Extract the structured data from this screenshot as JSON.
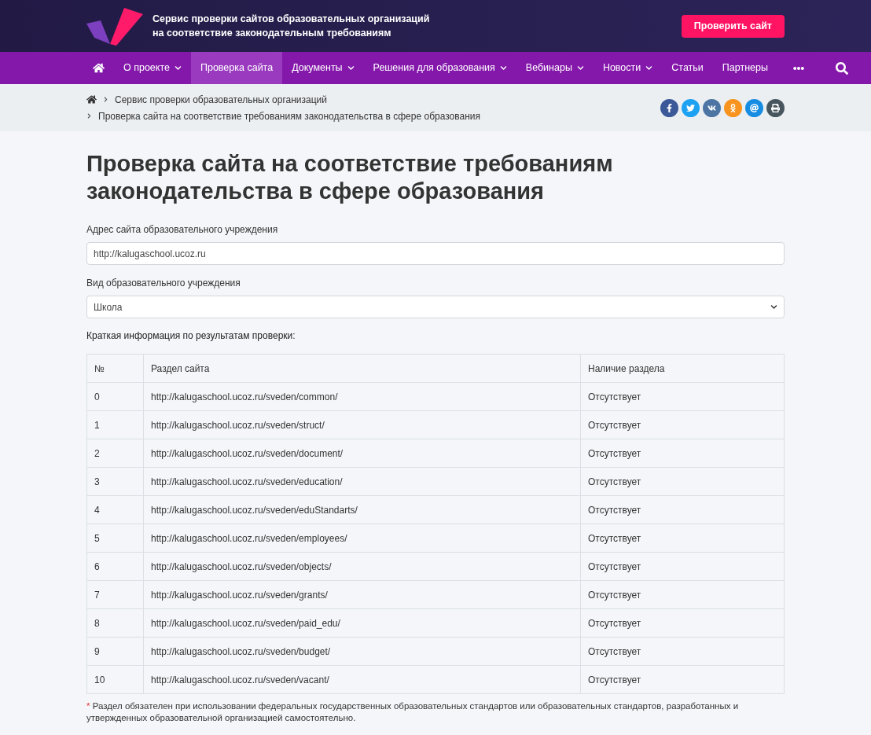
{
  "header": {
    "tagline": [
      "Сервис проверки сайтов образовательных организаций",
      "на соответствие законодательным требованиям"
    ],
    "cta": "Проверить сайт"
  },
  "nav": {
    "items": [
      {
        "kind": "home",
        "selected": false
      },
      {
        "label": "О проекте",
        "dropdown": true,
        "selected": false
      },
      {
        "label": "Проверка сайта",
        "dropdown": false,
        "selected": true
      },
      {
        "label": "Документы",
        "dropdown": true,
        "selected": false
      },
      {
        "label": "Решения для образования",
        "dropdown": true,
        "selected": false
      },
      {
        "label": "Вебинары",
        "dropdown": true,
        "selected": false
      },
      {
        "label": "Новости",
        "dropdown": true,
        "selected": false
      },
      {
        "label": "Статьи",
        "dropdown": false,
        "selected": false
      },
      {
        "label": "Партнеры",
        "dropdown": false,
        "selected": false
      },
      {
        "kind": "more",
        "selected": false
      },
      {
        "kind": "search",
        "selected": false
      }
    ]
  },
  "breadcrumbs": [
    "Сервис проверки образовательных организаций",
    "Проверка сайта на соответствие требованиям законодательства в сфере образования"
  ],
  "share": [
    {
      "kind": "facebook",
      "color": "#3b5998"
    },
    {
      "kind": "twitter",
      "color": "#1da1f2"
    },
    {
      "kind": "vk",
      "color": "#4c75a3"
    },
    {
      "kind": "ok",
      "color": "#f7931e"
    },
    {
      "kind": "mail",
      "color": "#168de2"
    },
    {
      "kind": "print",
      "color": "#47565e"
    }
  ],
  "title": "Проверка сайта на соответствие требованиям законодательства в сфере образования",
  "form": {
    "url_label": "Адрес сайта образовательного учреждения",
    "url_value": "http://kalugaschool.ucoz.ru",
    "type_label": "Вид образовательного учреждения",
    "type_value": "Школа"
  },
  "summary_label": "Краткая информация по результатам проверки:",
  "table": {
    "columns": [
      "№",
      "Раздел сайта",
      "Наличие раздела"
    ],
    "rows": [
      [
        "0",
        "http://kalugaschool.ucoz.ru/sveden/common/",
        "Отсутствует"
      ],
      [
        "1",
        "http://kalugaschool.ucoz.ru/sveden/struct/",
        "Отсутствует"
      ],
      [
        "2",
        "http://kalugaschool.ucoz.ru/sveden/document/",
        "Отсутствует"
      ],
      [
        "3",
        "http://kalugaschool.ucoz.ru/sveden/education/",
        "Отсутствует"
      ],
      [
        "4",
        "http://kalugaschool.ucoz.ru/sveden/eduStandarts/",
        "Отсутствует"
      ],
      [
        "5",
        "http://kalugaschool.ucoz.ru/sveden/employees/",
        "Отсутствует"
      ],
      [
        "6",
        "http://kalugaschool.ucoz.ru/sveden/objects/",
        "Отсутствует"
      ],
      [
        "7",
        "http://kalugaschool.ucoz.ru/sveden/grants/",
        "Отсутствует"
      ],
      [
        "8",
        "http://kalugaschool.ucoz.ru/sveden/paid_edu/",
        "Отсутствует"
      ],
      [
        "9",
        "http://kalugaschool.ucoz.ru/sveden/budget/",
        "Отсутствует"
      ],
      [
        "10",
        "http://kalugaschool.ucoz.ru/sveden/vacant/",
        "Отсутствует"
      ]
    ]
  },
  "footnote": {
    "marker": "*",
    "text": "Раздел обязателен при использовании федеральных государственных образовательных стандартов или образовательных стандартов, разработанных и утвержденных образовательной организацией самостоятельно."
  }
}
